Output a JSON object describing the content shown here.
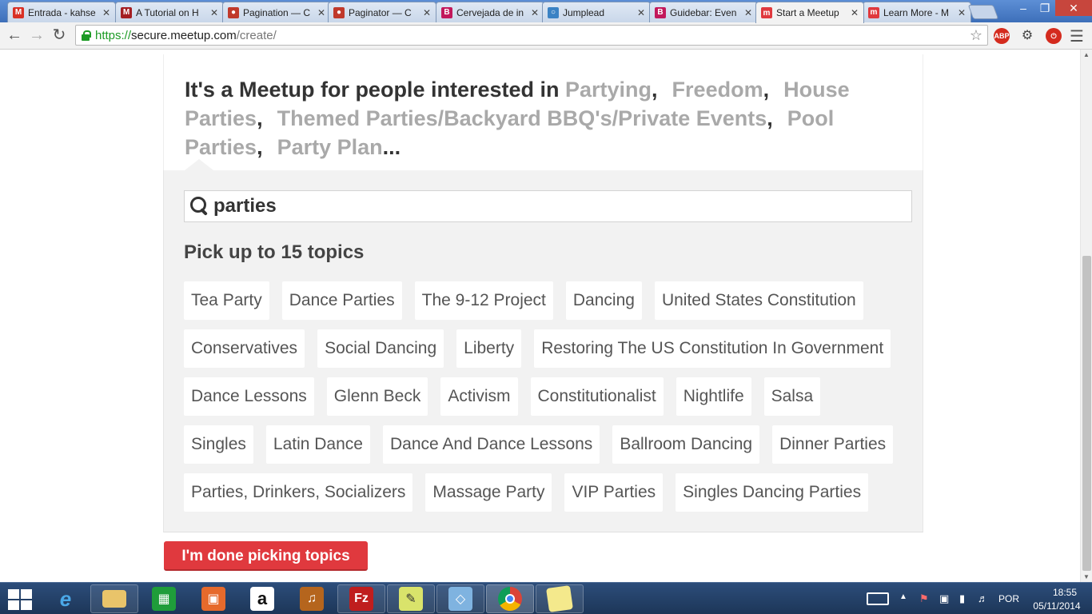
{
  "browser": {
    "tabs": [
      {
        "title": "Entrada - kahse",
        "favicon": "gmail-icon",
        "color": "#d93025",
        "glyph": "M",
        "active": false
      },
      {
        "title": "A Tutorial on H",
        "favicon": "m-icon",
        "color": "#a41e22",
        "glyph": "M",
        "active": false
      },
      {
        "title": "Pagination — C",
        "favicon": "circle-icon",
        "color": "#c0392b",
        "glyph": "●",
        "active": false
      },
      {
        "title": "Paginator — C",
        "favicon": "circle-icon",
        "color": "#c0392b",
        "glyph": "●",
        "active": false
      },
      {
        "title": "Cervejada de in",
        "favicon": "b-icon",
        "color": "#c2185b",
        "glyph": "B",
        "active": false
      },
      {
        "title": "Jumplead",
        "favicon": "globe-icon",
        "color": "#3b82c4",
        "glyph": "○",
        "active": false
      },
      {
        "title": "Guidebar: Even",
        "favicon": "b-icon",
        "color": "#c2185b",
        "glyph": "B",
        "active": false
      },
      {
        "title": "Start a Meetup",
        "favicon": "meetup-icon",
        "color": "#e0393e",
        "glyph": "m",
        "active": true
      },
      {
        "title": "Learn More - M",
        "favicon": "meetup-icon",
        "color": "#e0393e",
        "glyph": "m",
        "active": false
      }
    ],
    "url_scheme": "https://",
    "url_host": "secure.meetup.com",
    "url_path": "/create/",
    "ext_abp": "ABP"
  },
  "page": {
    "summary_prefix": "It's a Meetup for people interested in ",
    "summary_topics": [
      "Partying",
      "Freedom",
      "House Parties",
      "Themed Parties/Backyard BBQ's/Private Events",
      "Pool Parties"
    ],
    "summary_truncated": "Party Plan",
    "summary_ellipsis": "...",
    "search_value": "parties",
    "pick_heading": "Pick up to 15 topics",
    "topic_rows": [
      [
        "Tea Party",
        "Dance Parties",
        "The 9-12 Project",
        "Dancing",
        "United States Constitution"
      ],
      [
        "Conservatives",
        "Social Dancing",
        "Liberty",
        "Restoring The US Constitution In Government"
      ],
      [
        "Dance Lessons",
        "Glenn Beck",
        "Activism",
        "Constitutionalist",
        "Nightlife",
        "Salsa"
      ],
      [
        "Singles",
        "Latin Dance",
        "Dance And Dance Lessons",
        "Ballroom Dancing",
        "Dinner Parties"
      ],
      [
        "Parties, Drinkers, Socializers",
        "Massage Party",
        "VIP Parties",
        "Singles Dancing Parties"
      ]
    ],
    "done_button": "I'm done picking topics",
    "accent_color": "#e0393e"
  },
  "taskbar": {
    "apps": [
      "internet-explorer-icon",
      "file-explorer-icon",
      "store-icon",
      "office-icon",
      "amazon-icon",
      "media-icon",
      "filezilla-icon",
      "notepad-icon",
      "box-icon",
      "chrome-icon",
      "sticky-notes-icon"
    ],
    "amazon_glyph": "a",
    "filezilla_glyph": "Fz",
    "language": "POR",
    "time": "18:55",
    "date": "05/11/2014"
  }
}
